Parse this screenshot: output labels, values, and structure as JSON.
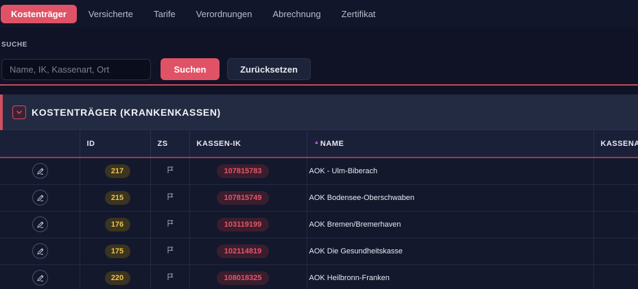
{
  "nav": {
    "tabs": [
      {
        "label": "Kostenträger",
        "active": true
      },
      {
        "label": "Versicherte",
        "active": false
      },
      {
        "label": "Tarife",
        "active": false
      },
      {
        "label": "Verordnungen",
        "active": false
      },
      {
        "label": "Abrechnung",
        "active": false
      },
      {
        "label": "Zertifikat",
        "active": false
      }
    ]
  },
  "search": {
    "label": "SUCHE",
    "placeholder": "Name, IK, Kassenart, Ort",
    "value": "",
    "submit_label": "Suchen",
    "reset_label": "Zurücksetzen"
  },
  "panel": {
    "title": "KOSTENTRÄGER (KRANKENKASSEN)"
  },
  "table": {
    "columns": [
      "",
      "ID",
      "ZS",
      "KASSEN-IK",
      "NAME",
      "KASSENA"
    ],
    "sort_column": "NAME",
    "rows": [
      {
        "id": "217",
        "ik": "107815783",
        "name": "AOK - Ulm-Biberach"
      },
      {
        "id": "215",
        "ik": "107815749",
        "name": "AOK Bodensee-Oberschwaben"
      },
      {
        "id": "176",
        "ik": "103119199",
        "name": "AOK Bremen/Bremerhaven"
      },
      {
        "id": "175",
        "ik": "102114819",
        "name": "AOK Die Gesundheitskasse"
      },
      {
        "id": "220",
        "ik": "108018325",
        "name": "AOK Heilbronn-Franken"
      }
    ]
  },
  "icons": {
    "edit": "pencil-icon",
    "zs": "flag-icon",
    "collapse": "chevron-down-icon",
    "sort": "sort-up-icon"
  },
  "colors": {
    "accent": "#e05265",
    "id_badge_text": "#f0c24a",
    "ik_badge_text": "#e8546a",
    "sort_arrow": "#c657d8"
  }
}
